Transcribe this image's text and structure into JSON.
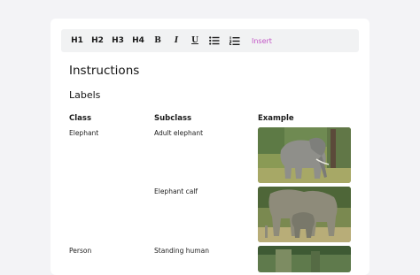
{
  "toolbar": {
    "h1": "H1",
    "h2": "H2",
    "h3": "H3",
    "h4": "H4",
    "bold": "B",
    "italic": "I",
    "underline": "U",
    "bullet_icon": "bulleted-list-icon",
    "numbered_icon": "numbered-list-icon",
    "insert": "Insert"
  },
  "content": {
    "title": "Instructions",
    "subtitle": "Labels",
    "table": {
      "headers": [
        "Class",
        "Subclass",
        "Example"
      ],
      "rows": [
        {
          "class": "Elephant",
          "subclass": "Adult elephant",
          "example_icon": "adult-elephant-photo"
        },
        {
          "class": "",
          "subclass": "Elephant calf",
          "example_icon": "elephant-calf-photo"
        },
        {
          "class": "Person",
          "subclass": "Standing human",
          "example_icon": "standing-human-photo"
        }
      ]
    }
  },
  "colors": {
    "insert": "#c254c6",
    "page_bg": "#f3f3f6",
    "toolbar_bg": "#f1f2f3"
  }
}
